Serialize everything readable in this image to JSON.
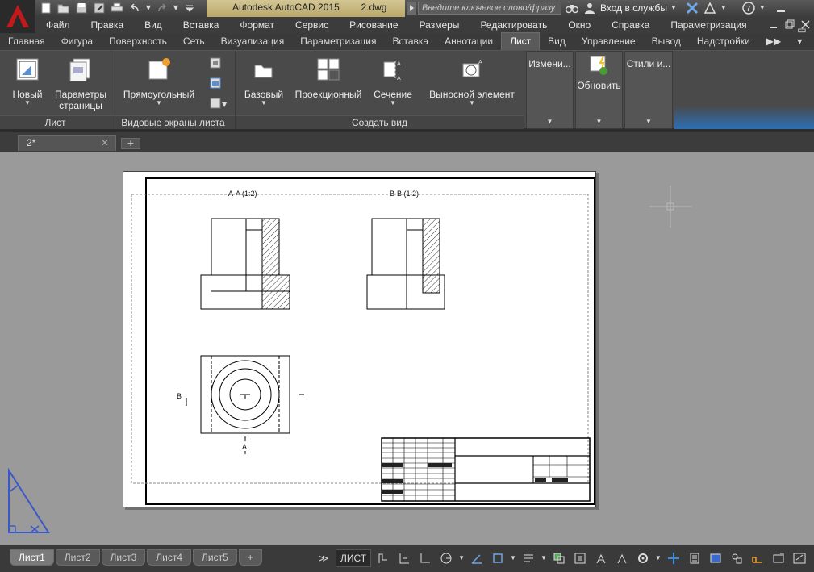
{
  "title": {
    "app": "Autodesk AutoCAD 2015",
    "file": "2.dwg"
  },
  "search": {
    "placeholder": "Введите ключевое слово/фразу"
  },
  "signin": {
    "label": "Вход в службы"
  },
  "menu": [
    "Файл",
    "Правка",
    "Вид",
    "Вставка",
    "Формат",
    "Сервис",
    "Рисование",
    "Размеры",
    "Редактировать",
    "Окно",
    "Справка",
    "Параметризация"
  ],
  "ribbon_tabs": [
    "Главная",
    "Фигура",
    "Поверхность",
    "Сеть",
    "Визуализация",
    "Параметризация",
    "Вставка",
    "Аннотации",
    "Лист",
    "Вид",
    "Управление",
    "Вывод",
    "Надстройки"
  ],
  "ribbon": {
    "panel_list": {
      "title": "Лист",
      "new": "Новый",
      "page_setup_1": "Параметры",
      "page_setup_2": "страницы"
    },
    "panel_viewports": {
      "title": "Видовые экраны листа",
      "rect": "Прямоугольный"
    },
    "panel_createview": {
      "title": "Создать вид",
      "base": "Базовый",
      "projected": "Проекционный",
      "section": "Сечение",
      "detail": "Выносной элемент"
    },
    "panel_modify": {
      "label": "Измени..."
    },
    "panel_update": {
      "label": "Обновить"
    },
    "panel_styles": {
      "label": "Стили и..."
    }
  },
  "doc_tab": {
    "label": "2*"
  },
  "drawing": {
    "view_aa": "A-A (1:2)",
    "view_bb": "B-B (1:2)",
    "marker_b": "B",
    "marker_a": "A"
  },
  "layout_tabs": [
    "Лист1",
    "Лист2",
    "Лист3",
    "Лист4",
    "Лист5"
  ],
  "status": {
    "space": "ЛИСТ"
  }
}
